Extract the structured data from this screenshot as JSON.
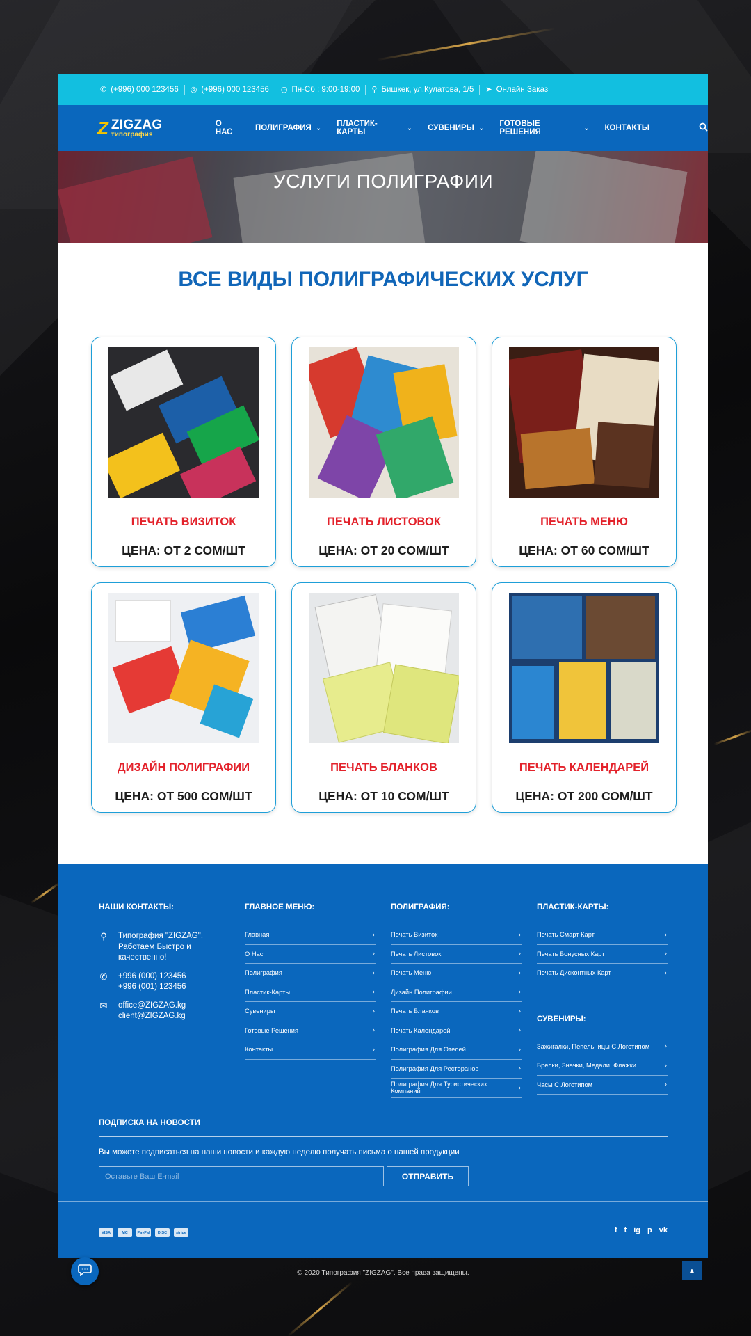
{
  "topbar": {
    "phone1": "(+996) 000 123456",
    "phone2": "(+996) 000 123456",
    "hours": "Пн-Сб : 9:00-19:00",
    "address": "Бишкек, ул.Кулатова, 1/5",
    "order": "Онлайн Заказ"
  },
  "logo": {
    "name": "ZIGZAG",
    "sub": "типография",
    "mark": "Z"
  },
  "nav": {
    "items": [
      {
        "label": "О НАС"
      },
      {
        "label": "ПОЛИГРАФИЯ"
      },
      {
        "label": "ПЛАСТИК-КАРТЫ"
      },
      {
        "label": "СУВЕНИРЫ"
      },
      {
        "label": "ГОТОВЫЕ РЕШЕНИЯ"
      },
      {
        "label": "КОНТАКТЫ"
      }
    ]
  },
  "hero": {
    "title": "УСЛУГИ ПОЛИГРАФИИ"
  },
  "section": {
    "title": "ВСЕ ВИДЫ ПОЛИГРАФИЧЕСКИХ УСЛУГ"
  },
  "cards": [
    {
      "title": "ПЕЧАТЬ ВИЗИТОК",
      "price": "ЦЕНА: ОТ 2 СОМ/ШТ"
    },
    {
      "title": "ПЕЧАТЬ ЛИСТОВОК",
      "price": "ЦЕНА: ОТ 20 СОМ/ШТ"
    },
    {
      "title": "ПЕЧАТЬ МЕНЮ",
      "price": "ЦЕНА: ОТ 60 СОМ/ШТ"
    },
    {
      "title": "ДИЗАЙН ПОЛИГРАФИИ",
      "price": "ЦЕНА: ОТ 500 СОМ/ШТ"
    },
    {
      "title": "ПЕЧАТЬ БЛАНКОВ",
      "price": "ЦЕНА: ОТ 10 СОМ/ШТ"
    },
    {
      "title": "ПЕЧАТЬ КАЛЕНДАРЕЙ",
      "price": "ЦЕНА: ОТ 200 СОМ/ШТ"
    }
  ],
  "footer": {
    "contacts": {
      "heading": "НАШИ КОНТАКТЫ:",
      "company_l1": "Типография \"ZIGZAG\".",
      "company_l2": "Работаем Быстро и",
      "company_l3": "качественно!",
      "phone1": "+996 (000) 123456",
      "phone2": "+996 (001) 123456",
      "email1": "office@ZIGZAG.kg",
      "email2": "client@ZIGZAG.kg"
    },
    "main_menu": {
      "heading": "ГЛАВНОЕ МЕНЮ:",
      "links": [
        "Главная",
        "О Нас",
        "Полиграфия",
        "Пластик-Карты",
        "Сувениры",
        "Готовые Решения",
        "Контакты"
      ]
    },
    "printing": {
      "heading": "ПОЛИГРАФИЯ:",
      "links": [
        "Печать Визиток",
        "Печать Листовок",
        "Печать Меню",
        "Дизайн Полиграфии",
        "Печать Бланков",
        "Печать Календарей",
        "Полиграфия Для Отелей",
        "Полиграфия Для Ресторанов",
        "Полиграфия Для Туристических Компаний"
      ]
    },
    "plastic": {
      "heading": "ПЛАСТИК-КАРТЫ:",
      "links": [
        "Печать Смарт Карт",
        "Печать Бонусных Карт",
        "Печать Дисконтных Карт"
      ]
    },
    "souvenirs": {
      "heading": "СУВЕНИРЫ:",
      "links": [
        "Зажигалки, Пепельницы С Логотипом",
        "Брелки, Значки, Медали, Флажки",
        "Часы С Логотипом"
      ]
    },
    "subscribe": {
      "heading": "ПОДПИСКА НА НОВОСТИ",
      "text": "Вы можете подписаться на наши новости и каждую неделю получать письма о нашей продукции",
      "placeholder": "Оставьте Ваш E-mail",
      "button": "ОТПРАВИТЬ"
    },
    "payments": [
      "VISA",
      "MC",
      "PayPal",
      "DISC",
      "stripe"
    ],
    "socials": [
      "f",
      "t",
      "ig",
      "p",
      "vk"
    ],
    "copyright": "© 2020 Типография \"ZIGZAG\". Все права защищены."
  },
  "colors": {
    "brand_blue": "#0a67bd",
    "topbar_cyan": "#12bfe0",
    "card_title_red": "#e3222b",
    "section_title_blue": "#1166b8"
  }
}
